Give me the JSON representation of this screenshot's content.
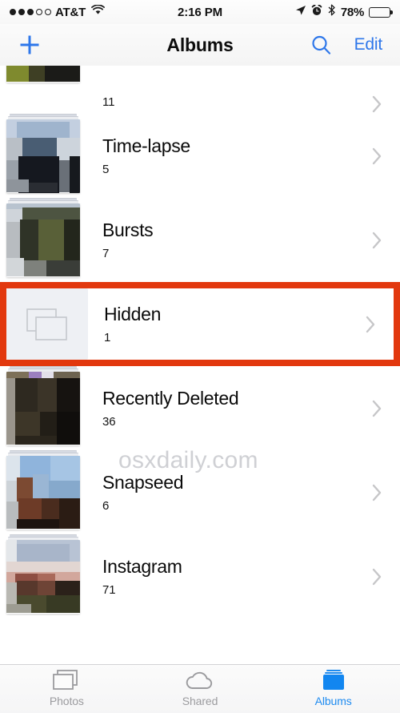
{
  "status_bar": {
    "signal_dots_filled": 3,
    "signal_dots_total": 5,
    "carrier": "AT&T",
    "wifi_icon": "wifi-icon",
    "time": "2:16 PM",
    "location_icon": "location-arrow-icon",
    "alarm_icon": "alarm-clock-icon",
    "bluetooth_icon": "bluetooth-icon",
    "battery_percent": "78%",
    "battery_level": 78
  },
  "nav_bar": {
    "add_icon": "plus-icon",
    "title": "Albums",
    "search_icon": "search-icon",
    "edit_label": "Edit"
  },
  "albums": [
    {
      "name": "",
      "count": "11",
      "partial": true,
      "thumb": "olive-dark-photo",
      "chevron": "chevron-right-icon",
      "highlighted": false
    },
    {
      "name": "Time-lapse",
      "count": "5",
      "partial": false,
      "thumb": "blue-gray-dark-photo",
      "chevron": "chevron-right-icon",
      "highlighted": false
    },
    {
      "name": "Bursts",
      "count": "7",
      "partial": false,
      "thumb": "olive-green-photo",
      "chevron": "chevron-right-icon",
      "highlighted": false
    },
    {
      "name": "Hidden",
      "count": "1",
      "partial": false,
      "thumb": "placeholder-stacked-photos-icon",
      "chevron": "chevron-right-icon",
      "highlighted": true
    },
    {
      "name": "Recently Deleted",
      "count": "36",
      "partial": false,
      "thumb": "dark-brown-photo",
      "chevron": "chevron-right-icon",
      "highlighted": false
    },
    {
      "name": "Snapseed",
      "count": "6",
      "partial": false,
      "thumb": "sky-building-photo",
      "chevron": "chevron-right-icon",
      "highlighted": false
    },
    {
      "name": "Instagram",
      "count": "71",
      "partial": false,
      "thumb": "landscape-sunset-photo",
      "chevron": "chevron-right-icon",
      "highlighted": false
    }
  ],
  "watermark": "osxdaily.com",
  "tab_bar": {
    "tabs": [
      {
        "label": "Photos",
        "icon": "photos-stack-icon",
        "active": false
      },
      {
        "label": "Shared",
        "icon": "cloud-icon",
        "active": false
      },
      {
        "label": "Albums",
        "icon": "albums-folder-icon",
        "active": true
      }
    ]
  },
  "colors": {
    "highlight_red": "#e2380e",
    "tint_blue": "#2e77ea",
    "active_tab_blue": "#1e8bf0",
    "placeholder_bg": "#eef0f4",
    "watermark_gray": "#cfd0d4"
  }
}
